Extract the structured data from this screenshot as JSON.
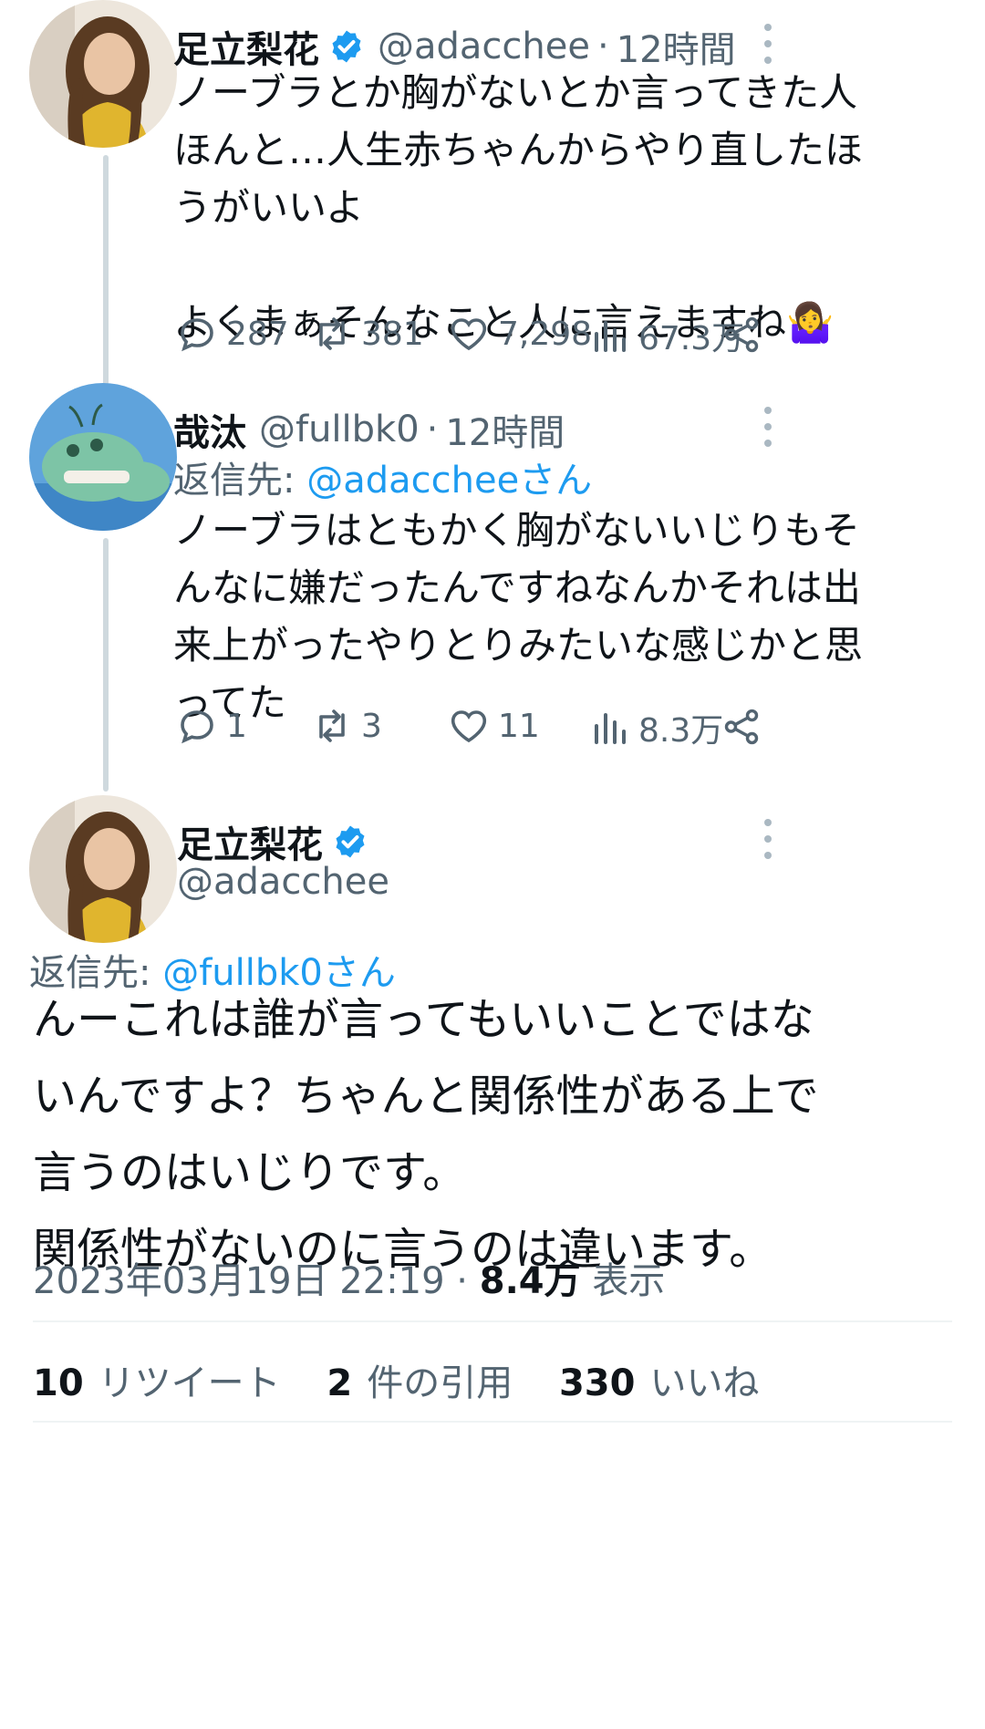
{
  "tweet1": {
    "name": "足立梨花",
    "handle": "@adacchee",
    "time": "12時間",
    "text": "ノーブラとか胸がないとか言ってきた人\nほんと…人生赤ちゃんからやり直したほ\nうがいいよ\n\nよくまぁそんなこと人に言えますね🤷‍♀️",
    "replies": "287",
    "retweets": "381",
    "likes": "7,298",
    "views": "67.3万"
  },
  "tweet2": {
    "name": "哉汰",
    "handle": "@fullbk0",
    "time": "12時間",
    "reply_prefix": "返信先: ",
    "reply_mention": "@adaccheeさん",
    "text": "ノーブラはともかく胸がないいじりもそ\nんなに嫌だったんですねなんかそれは出\n来上がったやりとりみたいな感じかと思\nってた",
    "replies": "1",
    "retweets": "3",
    "likes": "11",
    "views": "8.3万"
  },
  "tweet3": {
    "name": "足立梨花",
    "handle": "@adacchee",
    "reply_prefix": "返信先: ",
    "reply_mention": "@fullbk0さん",
    "text": "んーこれは誰が言ってもいいことではな\nいんですよ？ちゃんと関係性がある上で\n言うのはいじりです。\n関係性がないのに言うのは違います。",
    "timestamp": "2023年03月19日 22:19 · ",
    "views_count": "8.4万",
    "views_label": " 表示",
    "retweets_count": "10",
    "retweets_label": "リツイート",
    "quotes_count": "2",
    "quotes_label": "件の引用",
    "likes_count": "330",
    "likes_label": "いいね"
  },
  "separator": "·",
  "colors": {
    "text": "#0f1419",
    "secondary": "#536471",
    "accent": "#1d9bf0",
    "verified": "#1d9bf0",
    "divider": "#eff3f4"
  }
}
